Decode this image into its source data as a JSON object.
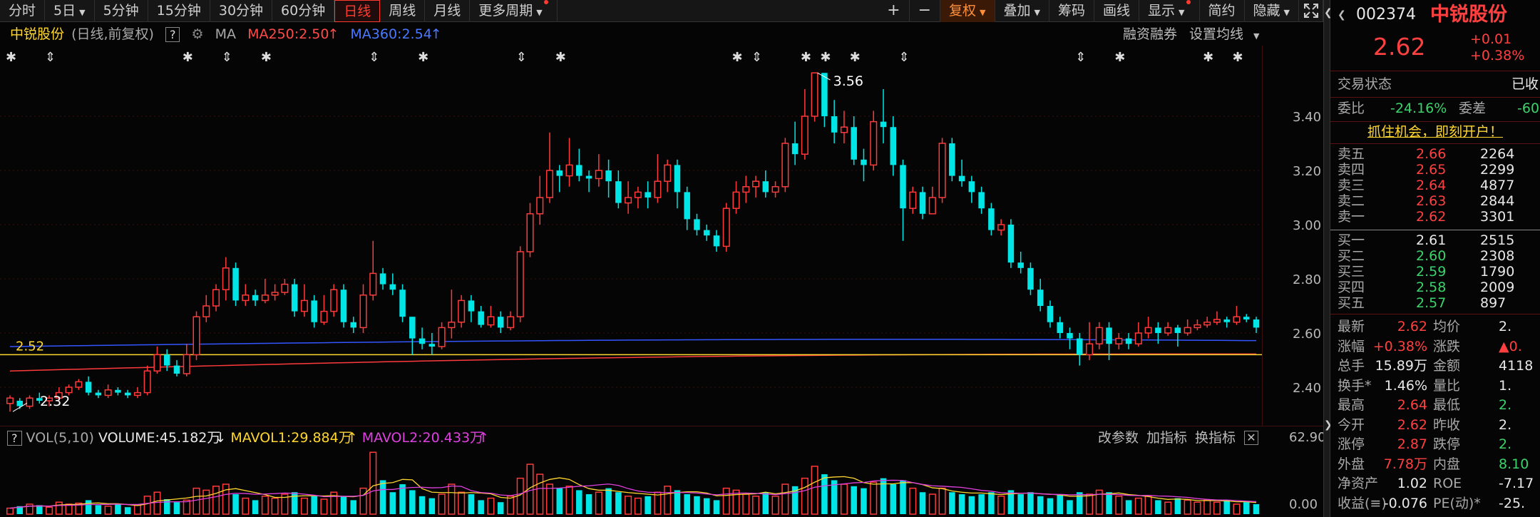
{
  "toolbar": {
    "periods": [
      "分时",
      "5日",
      "5分钟",
      "15分钟",
      "30分钟",
      "60分钟",
      "日线",
      "周线",
      "月线",
      "更多周期"
    ],
    "active_period": "日线",
    "right_buttons": [
      "+",
      "−",
      "复权",
      "叠加",
      "筹码",
      "画线",
      "显示",
      "简约",
      "隐藏"
    ]
  },
  "chart_header": {
    "stock_name": "中锐股份",
    "mode": "(日线,前复权)",
    "help": "?",
    "ma_label": "MA",
    "ma250": "MA250:2.50",
    "ma360": "MA360:2.54",
    "rzrq": "融资融券",
    "set_ma": "设置均线"
  },
  "chart_data": {
    "type": "candlestick",
    "y_ticks": [
      "3.40",
      "3.20",
      "3.00",
      "2.80",
      "2.60",
      "2.40"
    ],
    "ylim": [
      2.32,
      3.6
    ],
    "high_marker": "3.56",
    "low_marker": "2.32",
    "ref_line_value": "2.52",
    "candles": [
      [
        2.34,
        2.36,
        2.31,
        2.37
      ],
      [
        2.35,
        2.33,
        2.32,
        2.36
      ],
      [
        2.33,
        2.36,
        2.32,
        2.37
      ],
      [
        2.36,
        2.35,
        2.34,
        2.38
      ],
      [
        2.35,
        2.36,
        2.33,
        2.37
      ],
      [
        2.36,
        2.38,
        2.35,
        2.4
      ],
      [
        2.38,
        2.4,
        2.37,
        2.41
      ],
      [
        2.4,
        2.42,
        2.39,
        2.43
      ],
      [
        2.42,
        2.38,
        2.37,
        2.44
      ],
      [
        2.38,
        2.37,
        2.36,
        2.39
      ],
      [
        2.37,
        2.39,
        2.36,
        2.41
      ],
      [
        2.39,
        2.38,
        2.37,
        2.4
      ],
      [
        2.38,
        2.37,
        2.36,
        2.39
      ],
      [
        2.37,
        2.38,
        2.36,
        2.4
      ],
      [
        2.38,
        2.46,
        2.37,
        2.48
      ],
      [
        2.46,
        2.52,
        2.45,
        2.55
      ],
      [
        2.52,
        2.48,
        2.46,
        2.54
      ],
      [
        2.48,
        2.45,
        2.44,
        2.5
      ],
      [
        2.45,
        2.52,
        2.44,
        2.56
      ],
      [
        2.52,
        2.66,
        2.5,
        2.68
      ],
      [
        2.66,
        2.7,
        2.64,
        2.74
      ],
      [
        2.7,
        2.76,
        2.68,
        2.78
      ],
      [
        2.76,
        2.84,
        2.72,
        2.88
      ],
      [
        2.84,
        2.72,
        2.7,
        2.86
      ],
      [
        2.72,
        2.74,
        2.7,
        2.78
      ],
      [
        2.74,
        2.72,
        2.7,
        2.76
      ],
      [
        2.72,
        2.74,
        2.71,
        2.8
      ],
      [
        2.74,
        2.75,
        2.72,
        2.78
      ],
      [
        2.75,
        2.78,
        2.74,
        2.8
      ],
      [
        2.78,
        2.68,
        2.66,
        2.8
      ],
      [
        2.68,
        2.72,
        2.66,
        2.78
      ],
      [
        2.72,
        2.64,
        2.62,
        2.74
      ],
      [
        2.64,
        2.68,
        2.63,
        2.74
      ],
      [
        2.68,
        2.76,
        2.66,
        2.78
      ],
      [
        2.76,
        2.64,
        2.62,
        2.78
      ],
      [
        2.64,
        2.62,
        2.6,
        2.66
      ],
      [
        2.62,
        2.74,
        2.6,
        2.78
      ],
      [
        2.74,
        2.82,
        2.72,
        2.94
      ],
      [
        2.82,
        2.78,
        2.76,
        2.84
      ],
      [
        2.78,
        2.76,
        2.74,
        2.82
      ],
      [
        2.76,
        2.66,
        2.64,
        2.78
      ],
      [
        2.66,
        2.58,
        2.52,
        2.66
      ],
      [
        2.58,
        2.56,
        2.54,
        2.62
      ],
      [
        2.56,
        2.55,
        2.52,
        2.6
      ],
      [
        2.55,
        2.62,
        2.54,
        2.64
      ],
      [
        2.62,
        2.64,
        2.58,
        2.76
      ],
      [
        2.64,
        2.72,
        2.62,
        2.74
      ],
      [
        2.72,
        2.68,
        2.64,
        2.74
      ],
      [
        2.68,
        2.63,
        2.62,
        2.7
      ],
      [
        2.63,
        2.66,
        2.62,
        2.7
      ],
      [
        2.66,
        2.62,
        2.6,
        2.68
      ],
      [
        2.62,
        2.66,
        2.61,
        2.68
      ],
      [
        2.66,
        2.9,
        2.64,
        2.92
      ],
      [
        2.9,
        3.04,
        2.88,
        3.08
      ],
      [
        3.04,
        3.1,
        3.0,
        3.18
      ],
      [
        3.1,
        3.2,
        3.08,
        3.34
      ],
      [
        3.2,
        3.18,
        3.12,
        3.22
      ],
      [
        3.18,
        3.22,
        3.14,
        3.32
      ],
      [
        3.22,
        3.18,
        3.16,
        3.28
      ],
      [
        3.18,
        3.17,
        3.12,
        3.2
      ],
      [
        3.17,
        3.2,
        3.14,
        3.26
      ],
      [
        3.2,
        3.16,
        3.1,
        3.24
      ],
      [
        3.16,
        3.08,
        3.06,
        3.2
      ],
      [
        3.08,
        3.1,
        3.04,
        3.16
      ],
      [
        3.1,
        3.12,
        3.06,
        3.14
      ],
      [
        3.12,
        3.1,
        3.06,
        3.16
      ],
      [
        3.1,
        3.16,
        3.08,
        3.26
      ],
      [
        3.16,
        3.22,
        3.12,
        3.24
      ],
      [
        3.22,
        3.12,
        3.06,
        3.24
      ],
      [
        3.12,
        3.02,
        2.98,
        3.14
      ],
      [
        3.02,
        2.98,
        2.96,
        3.04
      ],
      [
        2.98,
        2.96,
        2.94,
        3.0
      ],
      [
        2.96,
        2.92,
        2.9,
        2.98
      ],
      [
        2.92,
        3.06,
        2.9,
        3.08
      ],
      [
        3.06,
        3.12,
        3.04,
        3.16
      ],
      [
        3.12,
        3.14,
        3.08,
        3.18
      ],
      [
        3.14,
        3.16,
        3.1,
        3.18
      ],
      [
        3.16,
        3.12,
        3.1,
        3.2
      ],
      [
        3.12,
        3.14,
        3.1,
        3.16
      ],
      [
        3.14,
        3.3,
        3.12,
        3.32
      ],
      [
        3.3,
        3.26,
        3.22,
        3.38
      ],
      [
        3.26,
        3.4,
        3.24,
        3.5
      ],
      [
        3.4,
        3.56,
        3.38,
        3.56
      ],
      [
        3.56,
        3.4,
        3.36,
        3.54
      ],
      [
        3.4,
        3.34,
        3.3,
        3.46
      ],
      [
        3.34,
        3.36,
        3.3,
        3.42
      ],
      [
        3.36,
        3.24,
        3.22,
        3.4
      ],
      [
        3.24,
        3.22,
        3.16,
        3.28
      ],
      [
        3.22,
        3.38,
        3.2,
        3.42
      ],
      [
        3.38,
        3.36,
        3.3,
        3.5
      ],
      [
        3.36,
        3.22,
        3.18,
        3.4
      ],
      [
        3.22,
        3.06,
        2.94,
        3.24
      ],
      [
        3.06,
        3.12,
        3.04,
        3.14
      ],
      [
        3.12,
        3.04,
        3.02,
        3.14
      ],
      [
        3.04,
        3.1,
        3.04,
        3.14
      ],
      [
        3.1,
        3.3,
        3.08,
        3.32
      ],
      [
        3.3,
        3.18,
        3.16,
        3.32
      ],
      [
        3.18,
        3.16,
        3.14,
        3.24
      ],
      [
        3.16,
        3.12,
        3.08,
        3.18
      ],
      [
        3.12,
        3.06,
        3.04,
        3.14
      ],
      [
        3.06,
        2.98,
        2.96,
        3.08
      ],
      [
        2.98,
        3.0,
        2.96,
        3.02
      ],
      [
        3.0,
        2.86,
        2.84,
        3.02
      ],
      [
        2.86,
        2.84,
        2.82,
        2.9
      ],
      [
        2.84,
        2.76,
        2.74,
        2.86
      ],
      [
        2.76,
        2.7,
        2.68,
        2.8
      ],
      [
        2.7,
        2.64,
        2.62,
        2.72
      ],
      [
        2.64,
        2.6,
        2.58,
        2.66
      ],
      [
        2.6,
        2.58,
        2.54,
        2.62
      ],
      [
        2.58,
        2.52,
        2.48,
        2.6
      ],
      [
        2.52,
        2.56,
        2.5,
        2.64
      ],
      [
        2.56,
        2.62,
        2.54,
        2.64
      ],
      [
        2.62,
        2.56,
        2.5,
        2.64
      ],
      [
        2.56,
        2.58,
        2.54,
        2.6
      ],
      [
        2.58,
        2.56,
        2.54,
        2.6
      ],
      [
        2.56,
        2.6,
        2.55,
        2.64
      ],
      [
        2.6,
        2.62,
        2.58,
        2.66
      ],
      [
        2.62,
        2.6,
        2.56,
        2.64
      ],
      [
        2.6,
        2.62,
        2.59,
        2.64
      ],
      [
        2.62,
        2.6,
        2.55,
        2.63
      ],
      [
        2.6,
        2.62,
        2.59,
        2.65
      ],
      [
        2.62,
        2.63,
        2.61,
        2.65
      ],
      [
        2.63,
        2.64,
        2.62,
        2.66
      ],
      [
        2.64,
        2.65,
        2.63,
        2.68
      ],
      [
        2.65,
        2.64,
        2.62,
        2.66
      ],
      [
        2.64,
        2.66,
        2.63,
        2.7
      ],
      [
        2.66,
        2.65,
        2.64,
        2.67
      ],
      [
        2.65,
        2.62,
        2.6,
        2.66
      ]
    ],
    "volume": {
      "y_ticks": [
        "62.90",
        "0.00"
      ],
      "ylim": [
        0,
        62.9
      ],
      "values": [
        6,
        8,
        10,
        9,
        7,
        12,
        10,
        11,
        14,
        9,
        8,
        10,
        7,
        9,
        18,
        22,
        15,
        12,
        14,
        26,
        24,
        28,
        30,
        20,
        16,
        14,
        18,
        16,
        20,
        22,
        16,
        18,
        15,
        22,
        18,
        14,
        26,
        62,
        34,
        22,
        30,
        24,
        18,
        16,
        20,
        30,
        22,
        20,
        14,
        16,
        12,
        18,
        36,
        50,
        40,
        30,
        26,
        28,
        24,
        20,
        22,
        26,
        22,
        18,
        16,
        18,
        22,
        28,
        24,
        20,
        18,
        16,
        14,
        26,
        24,
        20,
        18,
        22,
        18,
        30,
        28,
        36,
        48,
        40,
        34,
        30,
        28,
        26,
        32,
        36,
        30,
        34,
        26,
        22,
        20,
        26,
        22,
        20,
        18,
        20,
        22,
        18,
        24,
        20,
        22,
        18,
        16,
        20,
        14,
        22,
        20,
        24,
        22,
        18,
        14,
        16,
        18,
        14,
        12,
        16,
        14,
        12,
        14,
        12,
        14,
        10,
        12,
        10
      ]
    }
  },
  "vol_header": {
    "help": "?",
    "vol": "VOL(5,10)",
    "volume": "VOLUME:45.182万",
    "mavol1": "MAVOL1:29.884万",
    "mavol2": "MAVOL2:20.433万",
    "btn_params": "改参数",
    "btn_add": "加指标",
    "btn_switch": "换指标"
  },
  "panel": {
    "code": "002374",
    "name": "中锐股份",
    "price": "2.62",
    "change": "+0.01",
    "change_pct": "+0.38%",
    "trade_status_label": "交易状态",
    "trade_status_value": "已收",
    "weibi_label": "委比",
    "weibi_value": "-24.16%",
    "weicha_label": "委差",
    "weicha_value": "-60",
    "promo": "抓住机会，即刻开户！",
    "asks": [
      {
        "label": "卖五",
        "price": "2.66",
        "vol": "2264"
      },
      {
        "label": "卖四",
        "price": "2.65",
        "vol": "2299"
      },
      {
        "label": "卖三",
        "price": "2.64",
        "vol": "4877"
      },
      {
        "label": "卖二",
        "price": "2.63",
        "vol": "2844"
      },
      {
        "label": "卖一",
        "price": "2.62",
        "vol": "3301"
      }
    ],
    "bids": [
      {
        "label": "买一",
        "price": "2.61",
        "vol": "2515"
      },
      {
        "label": "买二",
        "price": "2.60",
        "vol": "2308"
      },
      {
        "label": "买三",
        "price": "2.59",
        "vol": "1790"
      },
      {
        "label": "买四",
        "price": "2.58",
        "vol": "2009"
      },
      {
        "label": "买五",
        "price": "2.57",
        "vol": "897"
      }
    ],
    "stats": [
      {
        "l1": "最新",
        "v1": "2.62",
        "c1": "red",
        "l2": "均价",
        "v2": "2.",
        "c2": "white"
      },
      {
        "l1": "涨幅",
        "v1": "+0.38%",
        "c1": "red",
        "l2": "涨跌",
        "v2": "▲0.",
        "c2": "red"
      },
      {
        "l1": "总手",
        "v1": "15.89万",
        "c1": "white",
        "l2": "金额",
        "v2": "4118",
        "c2": "white"
      },
      {
        "l1": "换手*",
        "v1": "1.46%",
        "c1": "white",
        "l2": "量比",
        "v2": "1.",
        "c2": "white"
      },
      {
        "l1": "最高",
        "v1": "2.64",
        "c1": "red",
        "l2": "最低",
        "v2": "2.",
        "c2": "green"
      },
      {
        "l1": "今开",
        "v1": "2.62",
        "c1": "red",
        "l2": "昨收",
        "v2": "2.",
        "c2": "white"
      },
      {
        "l1": "涨停",
        "v1": "2.87",
        "c1": "red",
        "l2": "跌停",
        "v2": "2.",
        "c2": "green"
      },
      {
        "l1": "外盘",
        "v1": "7.78万",
        "c1": "red",
        "l2": "内盘",
        "v2": "8.10",
        "c2": "green"
      },
      {
        "l1": "净资产",
        "v1": "1.02",
        "c1": "white",
        "l2": "ROE",
        "v2": "-7.17",
        "c2": "white"
      },
      {
        "l1": "收益(≡)",
        "v1": "-0.076",
        "c1": "white",
        "l2": "PE(动)*",
        "v2": "-25.",
        "c2": "white"
      }
    ]
  }
}
